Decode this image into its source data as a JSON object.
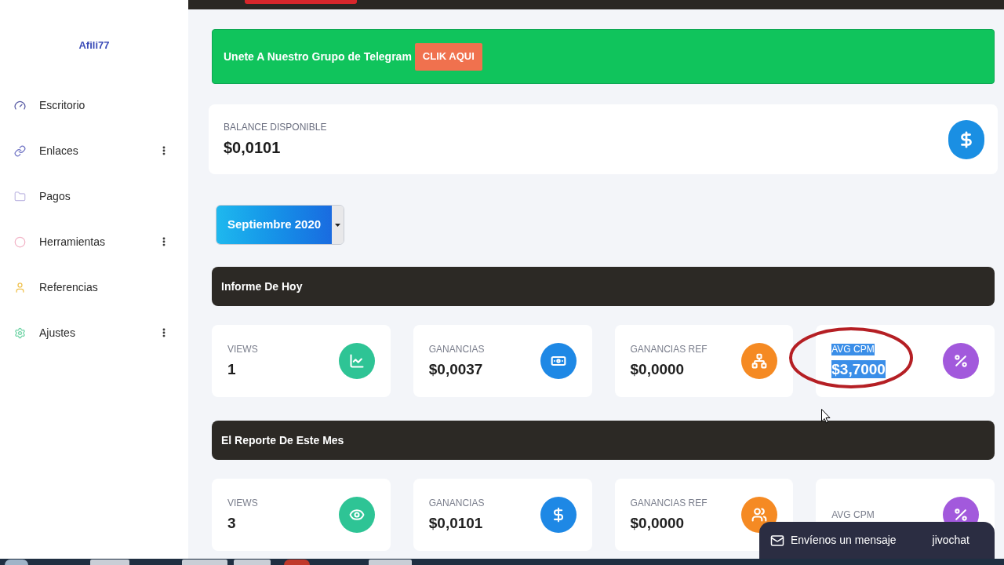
{
  "sidebar": {
    "brand": "Afili77",
    "items": [
      {
        "label": "Escritorio",
        "selected": false,
        "has_submenu": false
      },
      {
        "label": "Enlaces",
        "selected": false,
        "has_submenu": true
      },
      {
        "label": "Pagos",
        "selected": false,
        "has_submenu": false
      },
      {
        "label": "Herramientas",
        "selected": false,
        "has_submenu": true
      },
      {
        "label": "Referencias",
        "selected": false,
        "has_submenu": false
      },
      {
        "label": "Ajustes",
        "selected": false,
        "has_submenu": true
      }
    ]
  },
  "banner": {
    "text": "Unete A Nuestro Grupo de Telegram",
    "button": "CLIK AQUI"
  },
  "balance": {
    "label": "BALANCE DISPONIBLE",
    "value": "$0,0101"
  },
  "month_select": {
    "value": "Septiembre 2020"
  },
  "sections": [
    {
      "title": "Informe De Hoy",
      "cards": [
        {
          "label": "VIEWS",
          "value": "1",
          "color": "#2ec495",
          "text_selected": false,
          "circled": false
        },
        {
          "label": "GANANCIAS",
          "value": "$0,0037",
          "color": "#1e88e5",
          "text_selected": false,
          "circled": false
        },
        {
          "label": "GANANCIAS REF",
          "value": "$0,0000",
          "color": "#f58a23",
          "text_selected": false,
          "circled": false
        },
        {
          "label": "AVG CPM",
          "value": "$3,7000",
          "color": "#a259dc",
          "text_selected": true,
          "circled": true
        }
      ]
    },
    {
      "title": "El Reporte De Este Mes",
      "cards": [
        {
          "label": "VIEWS",
          "value": "3",
          "color": "#2ec495",
          "text_selected": false,
          "circled": false
        },
        {
          "label": "GANANCIAS",
          "value": "$0,0101",
          "color": "#1e88e5",
          "text_selected": false,
          "circled": false
        },
        {
          "label": "GANANCIAS REF",
          "value": "$0,0000",
          "color": "#f58a23",
          "text_selected": false,
          "circled": false
        },
        {
          "label": "AVG CPM",
          "color": "#a259dc",
          "text_selected": false,
          "circled": false
        }
      ]
    }
  ],
  "chat_widget": {
    "text": "Envíenos un mensaje",
    "brand": "jivochat"
  }
}
